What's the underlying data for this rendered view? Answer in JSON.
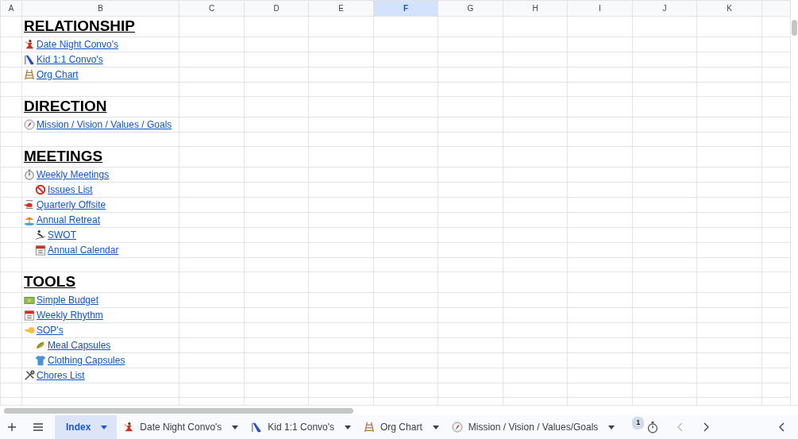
{
  "sheet": {
    "columns": [
      {
        "label": "A",
        "selected": false
      },
      {
        "label": "B",
        "selected": false
      },
      {
        "label": "C",
        "selected": false
      },
      {
        "label": "D",
        "selected": false
      },
      {
        "label": "E",
        "selected": false
      },
      {
        "label": "F",
        "selected": true
      },
      {
        "label": "G",
        "selected": false
      },
      {
        "label": "H",
        "selected": false
      },
      {
        "label": "I",
        "selected": false
      },
      {
        "label": "J",
        "selected": false
      },
      {
        "label": "K",
        "selected": false
      }
    ],
    "sections": [
      {
        "heading": "RELATIONSHIP",
        "links": [
          {
            "text": "Date Night Convo's"
          },
          {
            "text": "Kid 1:1 Convo's"
          },
          {
            "text": "Org Chart"
          }
        ]
      },
      {
        "heading": "DIRECTION",
        "links": [
          {
            "text": "Mission / Vision / Values / Goals"
          }
        ]
      },
      {
        "heading": "MEETINGS",
        "links": [
          {
            "text": "Weekly Meetings",
            "children": [
              {
                "text": "Issues List"
              }
            ]
          },
          {
            "text": "Quarterly Offsite"
          },
          {
            "text": "Annual Retreat",
            "children": [
              {
                "text": "SWOT"
              },
              {
                "text": "Annual Calendar"
              }
            ]
          }
        ]
      },
      {
        "heading": "TOOLS",
        "links": [
          {
            "text": "Simple Budget"
          },
          {
            "text": "Weekly Rhythm"
          },
          {
            "text": "SOP's",
            "children": [
              {
                "text": "Meal Capsules"
              },
              {
                "text": "Clothing Capsules"
              }
            ]
          },
          {
            "text": "Chores List"
          }
        ]
      }
    ]
  },
  "tab_bar": {
    "tabs": [
      {
        "label": "Index",
        "selected": true
      },
      {
        "label": "Date Night Convo's",
        "selected": false
      },
      {
        "label": "Kid 1:1 Convo's",
        "selected": false
      },
      {
        "label": "Org Chart",
        "selected": false
      },
      {
        "label": "Mission / Vision / Values/Goals",
        "selected": false
      }
    ],
    "badge": "1"
  }
}
